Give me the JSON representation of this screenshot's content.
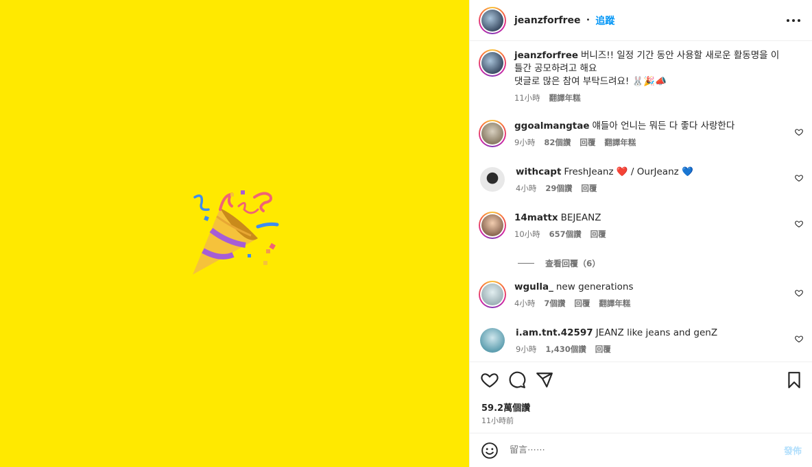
{
  "post": {
    "author": "jeanzforfree",
    "follow_label": "追蹤",
    "separator": "•"
  },
  "caption": {
    "username": "jeanzforfree",
    "text_line1": "버니즈!! 일정 기간 동안 사용할 새로운 활동명을 이",
    "text_line2": "틀간 공모하려고 해요",
    "text_line3": "댓글로 많은 참여 부탁드려요! 🐰🎉📣",
    "time": "11小時",
    "translate": "翻譯年糕"
  },
  "comments": [
    {
      "username": "ggoalmangtae",
      "text": "얘들아 언니는 뭐든 다 좋다 사랑한다",
      "time": "9小時",
      "likes": "82個讚",
      "reply": "回覆",
      "translate": "翻譯年糕"
    },
    {
      "username": "withcapt",
      "text": "FreshJeanz ❤️ / OurJeanz 💙",
      "time": "4小時",
      "likes": "29個讚",
      "reply": "回覆",
      "translate": ""
    },
    {
      "username": "14mattx",
      "text": "BEJEANZ",
      "time": "10小時",
      "likes": "657個讚",
      "reply": "回覆",
      "translate": ""
    },
    {
      "username": "wgulla_",
      "text": "new generations",
      "time": "4小時",
      "likes": "7個讚",
      "reply": "回覆",
      "translate": "翻譯年糕"
    },
    {
      "username": "i.am.tnt.42597",
      "text": "JEANZ like jeans and genZ",
      "time": "9小時",
      "likes": "1,430個讚",
      "reply": "回覆",
      "translate": ""
    }
  ],
  "view_replies": "查看回覆（6）",
  "stats": {
    "likes": "59.2萬個讚",
    "time": "11小時前"
  },
  "composer": {
    "placeholder": "留言⋯⋯",
    "post_label": "發佈"
  },
  "colors": {
    "media_bg": "#FFE900",
    "link": "#0095f6"
  }
}
